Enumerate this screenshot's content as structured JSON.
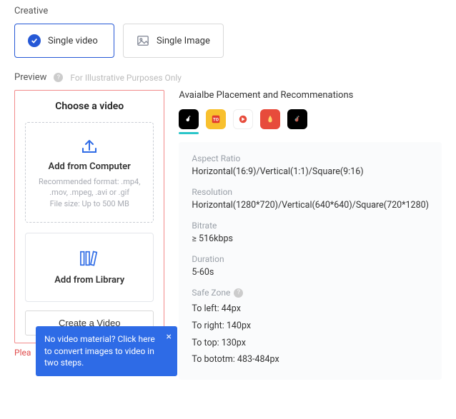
{
  "creative": {
    "label": "Creative",
    "options": {
      "singleVideo": "Single video",
      "singleImage": "Single Image"
    }
  },
  "preview": {
    "label": "Preview",
    "hint": "For Illustrative Purposes Only",
    "chooseTitle": "Choose a video",
    "addFromComputer": {
      "title": "Add from Computer",
      "hint1": "Recommended format: .mp4, .mov, .mpeg, .avi or .gif",
      "hint2": "File size: Up to 500 MB"
    },
    "addFromLibrary": {
      "title": "Add from Library"
    },
    "createBtn": "Create a Video",
    "error": "Plea",
    "tooltip": "No video material? Click here to convert images to video in two steps."
  },
  "placement": {
    "title": "Avaialbe Placement and Recommenations",
    "specs": {
      "aspectRatio": {
        "label": "Aspect Ratio",
        "value": "Horizontal(16:9)/Vertical(1:1)/Square(9:16)"
      },
      "resolution": {
        "label": "Resolution",
        "value": "Horizontal(1280*720)/Vertical(640*640)/Square(720*1280)"
      },
      "bitrate": {
        "label": "Bitrate",
        "value": "≥ 516kbps"
      },
      "duration": {
        "label": "Duration",
        "value": "5-60s"
      },
      "safeZone": {
        "label": "Safe Zone",
        "left": "To left: 44px",
        "right": "To right: 140px",
        "top": "To top: 130px",
        "bottom": "To bototm: 483-484px"
      }
    }
  }
}
